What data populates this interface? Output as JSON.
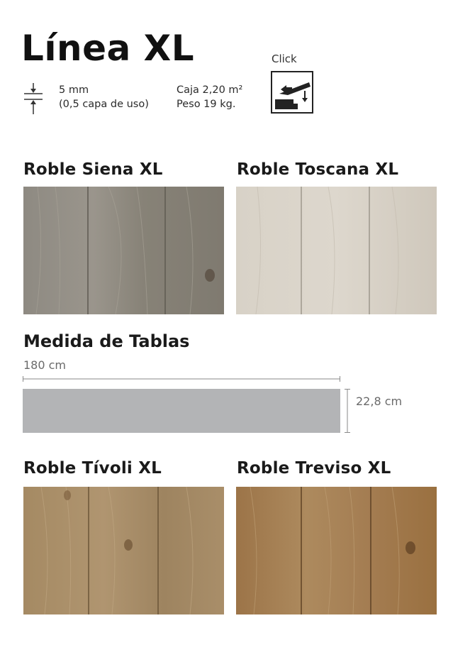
{
  "header": {
    "title": "Línea XL",
    "thickness_main": "5 mm",
    "thickness_sub": "(0,5 capa de uso)",
    "box": "Caja 2,20 m²",
    "weight": "Peso 19 kg.",
    "click_label": "Click"
  },
  "products": [
    {
      "name": "Roble Siena XL",
      "color": "#8f8a80"
    },
    {
      "name": "Roble Toscana XL",
      "color": "#d6d0c5"
    },
    {
      "name": "Roble Tívoli XL",
      "color": "#a4865c"
    },
    {
      "name": "Roble Treviso XL",
      "color": "#a17a4e"
    }
  ],
  "dimensions": {
    "title": "Medida de Tablas",
    "length": "180 cm",
    "width": "22,8 cm",
    "plank_color": "#b3b4b6"
  },
  "icons": [
    "thickness-icon",
    "click-install-icon"
  ]
}
